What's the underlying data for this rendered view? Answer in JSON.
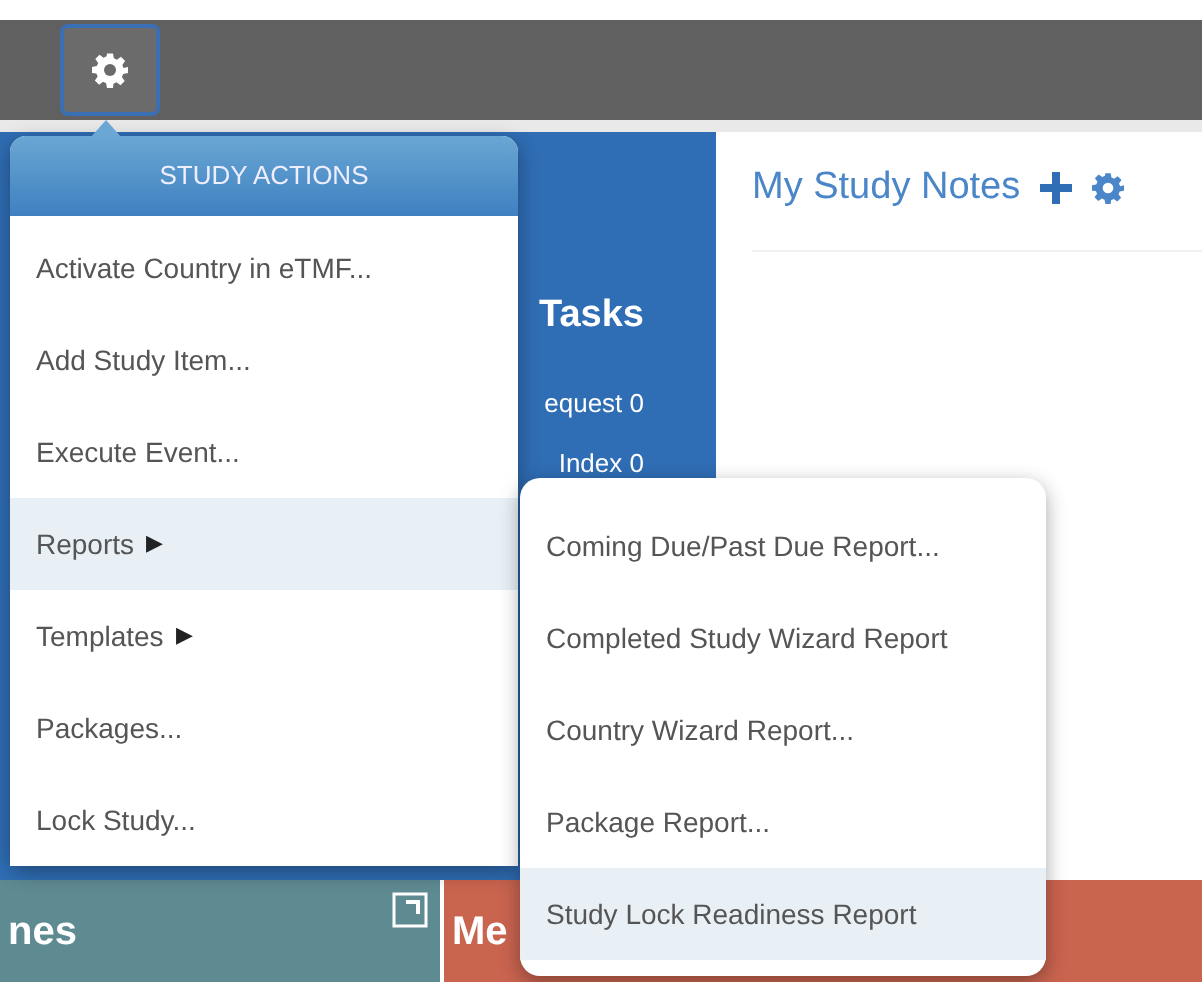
{
  "tasks_panel": {
    "title": "Tasks",
    "rows": [
      "equest 0",
      "Index 0"
    ]
  },
  "notes_panel": {
    "title": "My Study Notes"
  },
  "tiles": [
    {
      "label": "nes",
      "color": "#5e8a92",
      "expand": true
    },
    {
      "label": "Me",
      "color": "#c9644f",
      "expand": false
    }
  ],
  "study_actions_menu": {
    "title": "STUDY ACTIONS",
    "items": [
      {
        "label": "Activate Country in eTMF...",
        "kind": "action",
        "selected": false
      },
      {
        "label": "Add Study Item...",
        "kind": "action",
        "selected": false
      },
      {
        "label": "Execute Event...",
        "kind": "action",
        "selected": false
      },
      {
        "label": "Reports",
        "arrow": "▶",
        "kind": "submenu",
        "selected": true
      },
      {
        "label": "Templates",
        "arrow": "▶",
        "kind": "submenu",
        "selected": false
      },
      {
        "label": "Packages...",
        "kind": "action",
        "selected": false
      },
      {
        "label": "Lock Study...",
        "kind": "action",
        "selected": false
      }
    ]
  },
  "reports_submenu": {
    "items": [
      {
        "label": "Coming Due/Past Due Report...",
        "selected": false
      },
      {
        "label": "Completed Study Wizard Report",
        "selected": false
      },
      {
        "label": "Country Wizard Report...",
        "selected": false
      },
      {
        "label": "Package Report...",
        "selected": false
      },
      {
        "label": "Study Lock Readiness Report",
        "selected": true
      }
    ]
  }
}
